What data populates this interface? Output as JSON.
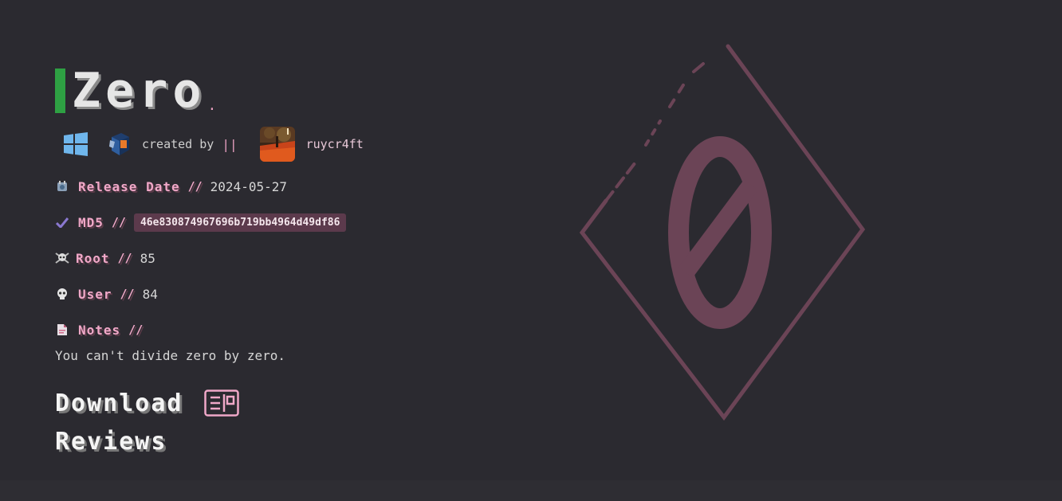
{
  "machine": {
    "title": "Zero",
    "title_dot": ".",
    "created_by_label": "created by",
    "separator": "||",
    "author": "ruycr4ft",
    "os_icon": "windows-icon",
    "platform_icon": "virtualbox-icon"
  },
  "fields": {
    "release_date": {
      "label": "Release Date",
      "sep": "//",
      "value": "2024-05-27",
      "icon": "calendar-icon"
    },
    "md5": {
      "label": "MD5",
      "sep": "//",
      "value": "46e830874967696b719bb4964d49df86",
      "icon": "check-icon"
    },
    "root": {
      "label": "Root",
      "sep": "//",
      "value": "85",
      "icon": "skull-crossbones-icon"
    },
    "user": {
      "label": "User",
      "sep": "//",
      "value": "84",
      "icon": "skull-icon"
    },
    "notes": {
      "label": "Notes",
      "sep": "//",
      "value": "You can't divide zero by zero.",
      "icon": "note-icon"
    }
  },
  "links": {
    "download": "Download",
    "reviews": "Reviews"
  },
  "colors": {
    "background": "#2b2a30",
    "accent_pink": "#f0a8c8",
    "title_bar": "#2ea043",
    "md5_bg": "#5c3a4c",
    "logo": "#6b4456"
  }
}
